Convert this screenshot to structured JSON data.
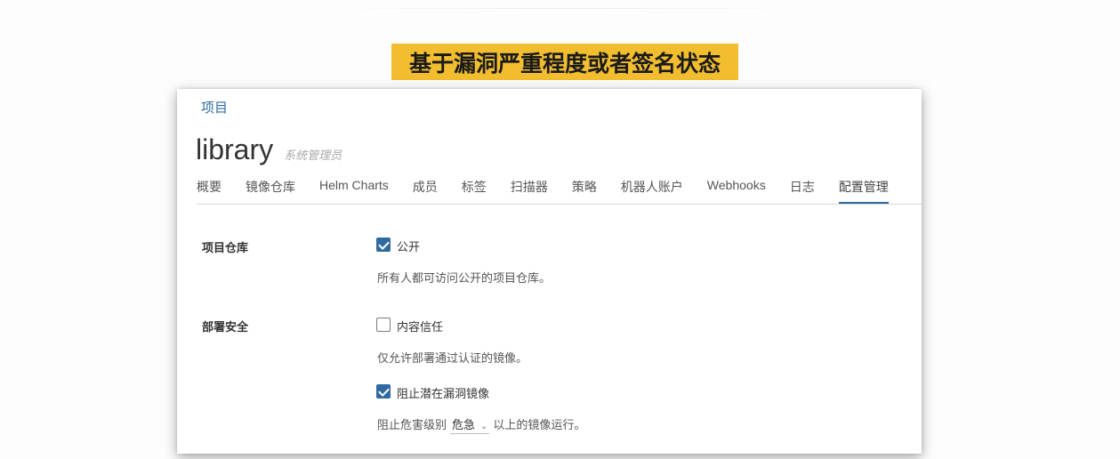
{
  "caption": "基于漏洞严重程度或者签名状态",
  "breadcrumb": "项目",
  "project": {
    "name": "library",
    "role": "系统管理员"
  },
  "tabs": [
    {
      "label": "概要"
    },
    {
      "label": "镜像仓库"
    },
    {
      "label": "Helm Charts"
    },
    {
      "label": "成员"
    },
    {
      "label": "标签"
    },
    {
      "label": "扫描器"
    },
    {
      "label": "策略"
    },
    {
      "label": "机器人账户"
    },
    {
      "label": "Webhooks"
    },
    {
      "label": "日志"
    },
    {
      "label": "配置管理",
      "active": true
    }
  ],
  "settings": {
    "repo": {
      "label": "项目仓库",
      "public_checked": true,
      "public_label": "公开",
      "public_help": "所有人都可访问公开的项目仓库。"
    },
    "deploy": {
      "label": "部署安全",
      "trust_checked": false,
      "trust_label": "内容信任",
      "trust_help": "仅允许部署通过认证的镜像。",
      "block_checked": true,
      "block_label": "阻止潜在漏洞镜像",
      "block_help_prefix": "阻止危害级别",
      "severity": "危急",
      "block_help_suffix": "以上的镜像运行。"
    }
  },
  "icons": {
    "checkbox_checked": "check-icon",
    "select": "chevron-down-icon"
  },
  "colors": {
    "caption_bg": "#f2bd2f",
    "accent": "#2f6aa0"
  }
}
